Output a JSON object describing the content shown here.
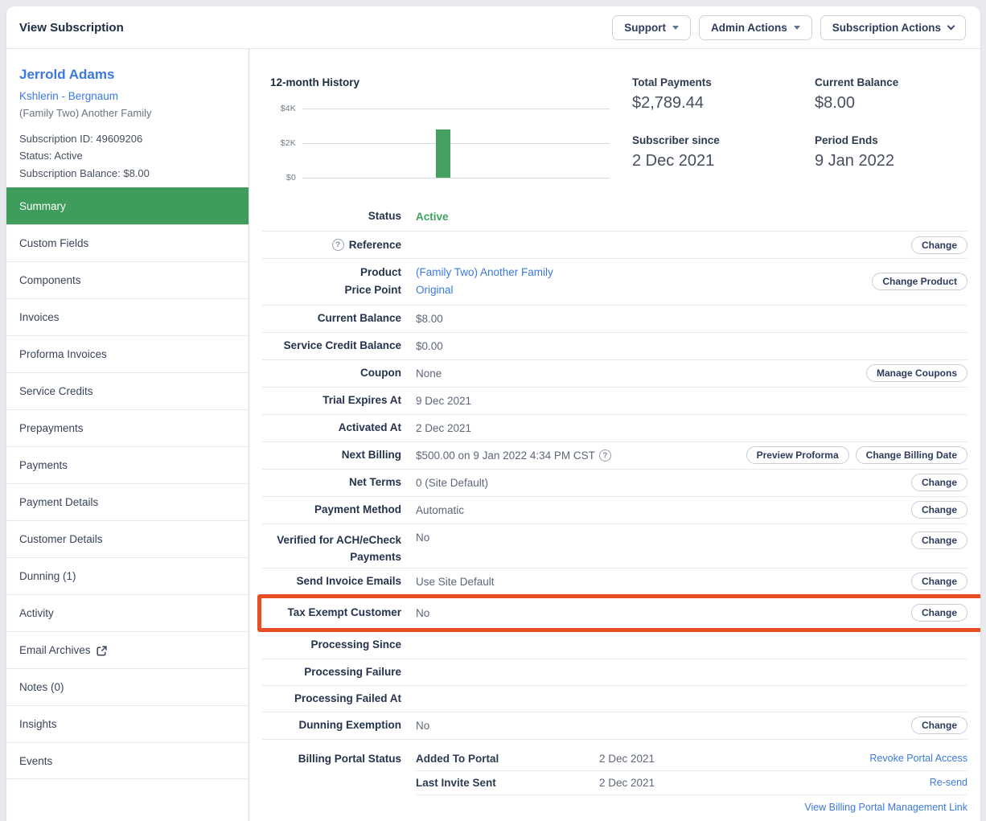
{
  "header": {
    "title": "View Subscription",
    "buttons": [
      {
        "label": "Support"
      },
      {
        "label": "Admin Actions"
      },
      {
        "label": "Subscription Actions"
      }
    ]
  },
  "sidebar": {
    "customer_name": "Jerrold Adams",
    "customer_company": "Kshlerin - Bergnaum",
    "product_line": "(Family Two) Another Family",
    "subscription_id_line": "Subscription ID: 49609206",
    "status_line": "Status: Active",
    "balance_line": "Subscription Balance: $8.00",
    "nav": [
      {
        "label": "Summary",
        "selected": true
      },
      {
        "label": "Custom Fields"
      },
      {
        "label": "Components"
      },
      {
        "label": "Invoices"
      },
      {
        "label": "Proforma Invoices"
      },
      {
        "label": "Service Credits"
      },
      {
        "label": "Prepayments"
      },
      {
        "label": "Payments"
      },
      {
        "label": "Payment Details"
      },
      {
        "label": "Customer Details"
      },
      {
        "label": "Dunning (1)"
      },
      {
        "label": "Activity"
      },
      {
        "label": "Email Archives",
        "external": true
      },
      {
        "label": "Notes (0)"
      },
      {
        "label": "Insights"
      },
      {
        "label": "Events"
      }
    ]
  },
  "overview": {
    "chart_title": "12-month History",
    "stats": [
      {
        "label": "Total Payments",
        "value": "$2,789.44"
      },
      {
        "label": "Current Balance",
        "value": "$8.00"
      },
      {
        "label": "Subscriber since",
        "value": "2 Dec 2021"
      },
      {
        "label": "Period Ends",
        "value": "9 Jan 2022"
      }
    ]
  },
  "chart_data": {
    "type": "bar",
    "title": "12-month History",
    "categories": [
      "1",
      "2",
      "3",
      "4",
      "5",
      "6",
      "7",
      "8",
      "9",
      "10",
      "11",
      "12"
    ],
    "values": [
      0,
      0,
      0,
      0,
      0,
      2789.44,
      0,
      0,
      0,
      0,
      0,
      0
    ],
    "xlabel": "",
    "ylabel": "",
    "ytick_labels": [
      "$0",
      "$2K",
      "$4K"
    ],
    "ylim": [
      0,
      4000
    ],
    "grid": true,
    "x_tick_labels_shown": false,
    "bar_color": "#44a15e"
  },
  "icons": {
    "question_mark": "?"
  },
  "rows": {
    "status": {
      "label": "Status",
      "value": "Active"
    },
    "reference": {
      "label": "Reference",
      "button": "Change"
    },
    "product": {
      "label_1": "Product",
      "label_2": "Price Point",
      "value_1": "(Family Two) Another Family",
      "value_2": "Original",
      "button": "Change Product"
    },
    "current_balance": {
      "label": "Current Balance",
      "value": "$8.00"
    },
    "service_credit_balance": {
      "label": "Service Credit Balance",
      "value": "$0.00"
    },
    "coupon": {
      "label": "Coupon",
      "value": "None",
      "button": "Manage Coupons"
    },
    "trial_expires_at": {
      "label": "Trial Expires At",
      "value": "9 Dec 2021"
    },
    "activated_at": {
      "label": "Activated At",
      "value": "2 Dec 2021"
    },
    "next_billing": {
      "label": "Next Billing",
      "value": "$500.00 on 9 Jan 2022 4:34 PM CST",
      "buttons": [
        "Preview Proforma",
        "Change Billing Date"
      ]
    },
    "net_terms": {
      "label": "Net Terms",
      "value": "0 (Site Default)",
      "button": "Change"
    },
    "payment_method": {
      "label": "Payment Method",
      "value": "Automatic",
      "button": "Change"
    },
    "ach_verified": {
      "label": "Verified for ACH/eCheck Payments",
      "value": "No",
      "button": "Change"
    },
    "send_invoice_emails": {
      "label": "Send Invoice Emails",
      "value": "Use Site Default",
      "button": "Change"
    },
    "tax_exempt": {
      "label": "Tax Exempt Customer",
      "value": "No",
      "button": "Change"
    },
    "processing_since": {
      "label": "Processing Since"
    },
    "processing_failure": {
      "label": "Processing Failure"
    },
    "processing_failed_at": {
      "label": "Processing Failed At"
    },
    "dunning_exemption": {
      "label": "Dunning Exemption",
      "value": "No",
      "button": "Change"
    },
    "billing_portal": {
      "label": "Billing Portal Status",
      "added": {
        "name": "Added To Portal",
        "date": "2 Dec 2021",
        "link": "Revoke Portal Access"
      },
      "invite": {
        "name": "Last Invite Sent",
        "date": "2 Dec 2021",
        "link": "Re-send"
      },
      "manage_link": "View Billing Portal Management Link"
    }
  },
  "colors": {
    "accent_green": "#3f9d5b",
    "bar_green": "#44a15e",
    "status_green": "#3da161",
    "link_blue": "#3b79e0",
    "highlight_orange": "#e84e25"
  }
}
